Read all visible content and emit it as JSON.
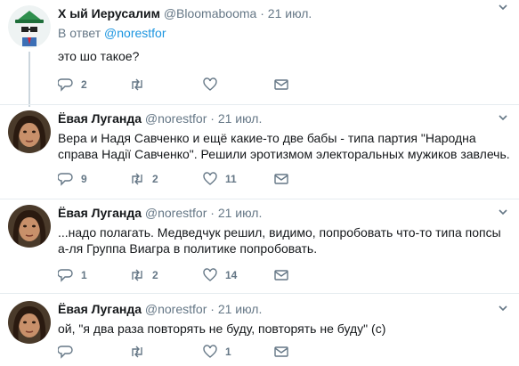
{
  "tweets": [
    {
      "name": "Х  ый Иерусалим",
      "handle": "@Bloomabooma",
      "sep": "·",
      "date": "21 июл.",
      "reply_prefix": "В ответ",
      "reply_handle": "@norestfor",
      "text": "это шо такое?",
      "replies": "2",
      "retweets": "",
      "likes": "",
      "avatar_icon": "green-hat-cartoon-avatar"
    },
    {
      "name": "Ёвая Луганда",
      "handle": "@norestfor",
      "sep": "·",
      "date": "21 июл.",
      "text": "Вера и Надя Савченко и ещё какие-то две бабы - типа партия \"Народна справа Надії Савченко\". Решили эротизмом электоральных мужиков завлечь.",
      "replies": "9",
      "retweets": "2",
      "likes": "11",
      "avatar_icon": "photo-avatar"
    },
    {
      "name": "Ёвая Луганда",
      "handle": "@norestfor",
      "sep": "·",
      "date": "21 июл.",
      "text": "...надо полагать. Медведчук решил, видимо, попробовать что-то типа попсы а-ля Группа Виагра в политике попробовать.",
      "replies": "1",
      "retweets": "2",
      "likes": "14",
      "avatar_icon": "photo-avatar"
    },
    {
      "name": "Ёвая Луганда",
      "handle": "@norestfor",
      "sep": "·",
      "date": "21 июл.",
      "text": "ой, \"я два раза повторять не буду, повторять не буду\" (с)",
      "replies": "",
      "retweets": "",
      "likes": "1",
      "avatar_icon": "photo-avatar"
    }
  ],
  "colors": {
    "accent": "#1b95e0",
    "muted": "#657786",
    "divider": "#e6ecf0"
  }
}
